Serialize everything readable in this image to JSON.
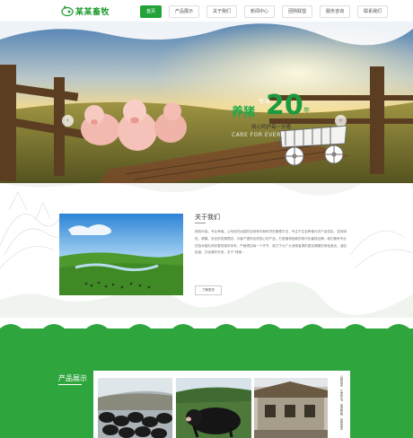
{
  "header": {
    "brand": "某某畜牧",
    "nav": [
      "首页",
      "产品展示",
      "关于我们",
      "新闻中心",
      "团购联盟",
      "服务咨询",
      "联系我们"
    ],
    "active_index": 0
  },
  "banner": {
    "slogan_prefix": "专业",
    "slogan_main": "养猪",
    "slogan_number": "20",
    "slogan_unit": "年",
    "slogan_sub": "用心呵护每一头猪",
    "slogan_en": "CARE FOR EVERY PIG WITH HEART",
    "prev": "‹",
    "next": "›"
  },
  "about": {
    "title": "关于我们",
    "body": "绿色环保，专业养殖。公司依托优越的自然条件和科学的管理方法，专注于生态养殖与农产品供应，坚持绿色、健康、安全的发展理念。为客户提供优质放心的产品，打造值得信赖的现代化畜牧品牌。我们拥有专业的技术团队和完善的服务体系，严格把控每一个环节，致力于为广大消费者提供更加健康的绿色食品，诚信经营，共创美好未来。关于“绿美...",
    "more": "了解更多"
  },
  "products": {
    "title": "产品展示",
    "side_text": "山林放养，生态环境，肉质鲜美，营养健康"
  },
  "colors": {
    "brand_green": "#24a23a",
    "section_green": "#2ea53d"
  }
}
